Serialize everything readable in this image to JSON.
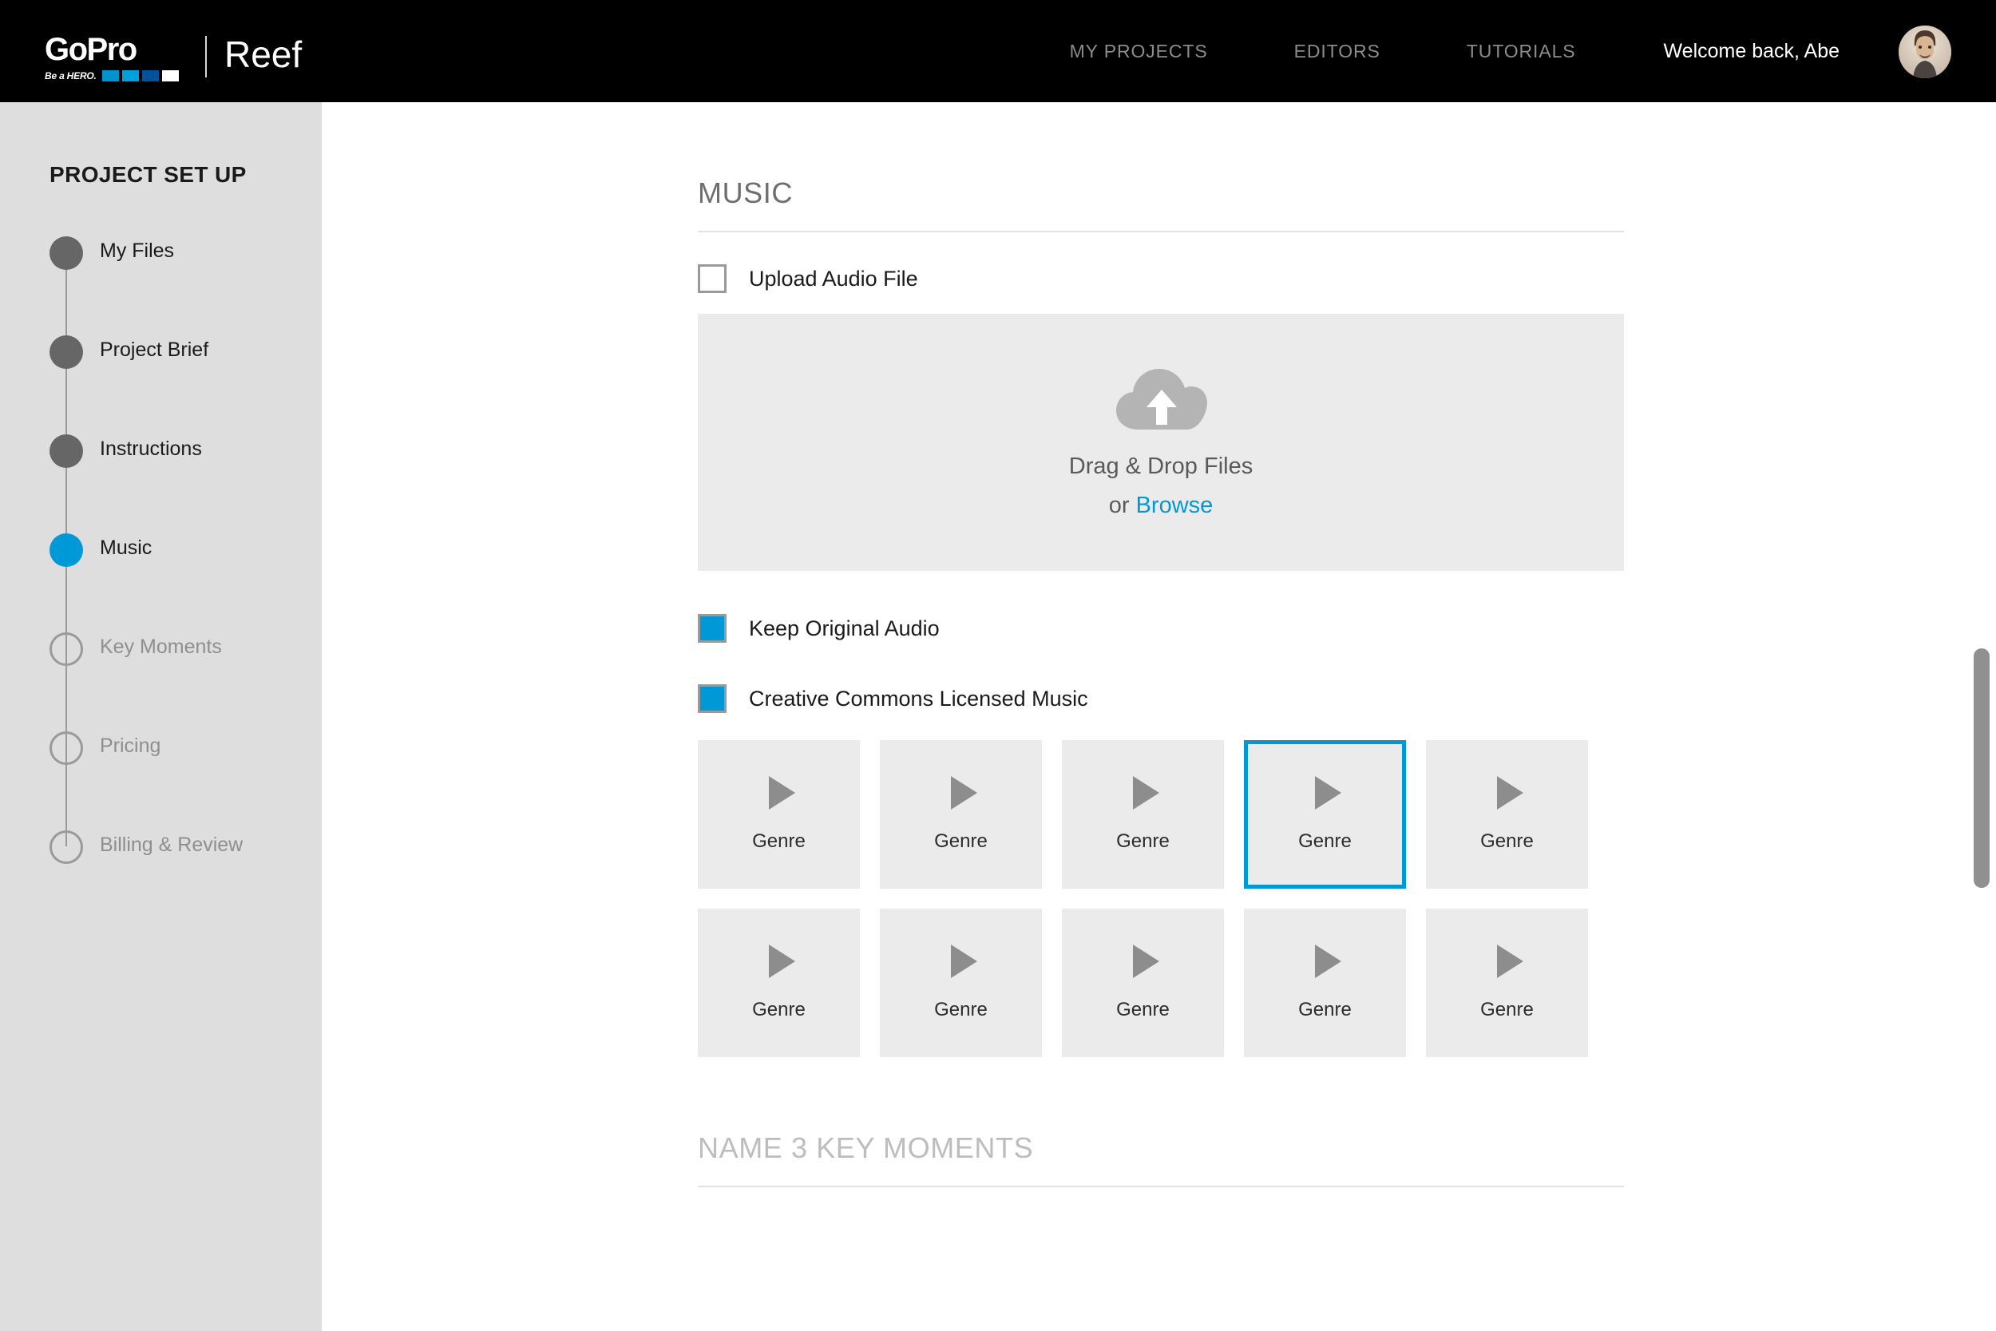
{
  "header": {
    "brand_name": "GoPro",
    "brand_tagline": "Be a HERO.",
    "product_name": "Reef",
    "divider": "|",
    "nav": [
      {
        "label": "MY PROJECTS"
      },
      {
        "label": "EDITORS"
      },
      {
        "label": "TUTORIALS"
      }
    ],
    "welcome_text": "Welcome back, Abe",
    "avatar_icon": "user-avatar-photo",
    "colors": {
      "background": "#000000",
      "nav_text": "#8c8c8c",
      "welcome_text": "#ffffff",
      "logo_sq1": "#0093d0",
      "logo_sq2": "#00a0dc",
      "logo_sq3": "#00539b",
      "logo_sq4": "#ffffff"
    }
  },
  "sidebar": {
    "title": "PROJECT SET UP",
    "background": "#dedede",
    "steps": [
      {
        "label": "My Files",
        "state": "complete"
      },
      {
        "label": "Project Brief",
        "state": "complete"
      },
      {
        "label": "Instructions",
        "state": "complete"
      },
      {
        "label": "Music",
        "state": "active"
      },
      {
        "label": "Key Moments",
        "state": "pending"
      },
      {
        "label": "Pricing",
        "state": "pending"
      },
      {
        "label": "Billing & Review",
        "state": "pending"
      }
    ]
  },
  "main": {
    "music_section": {
      "title": "MUSIC",
      "upload_audio": {
        "label": "Upload Audio File",
        "checked": false
      },
      "dropzone": {
        "icon": "cloud-upload-icon",
        "primary_text": "Drag & Drop Files",
        "or_text": "or ",
        "browse_label": "Browse"
      },
      "keep_original_audio": {
        "label": "Keep Original Audio",
        "checked": true
      },
      "creative_commons": {
        "label": "Creative Commons Licensed Music",
        "checked": true
      },
      "genre_tiles": [
        {
          "label": "Genre",
          "icon": "play-icon",
          "selected": false
        },
        {
          "label": "Genre",
          "icon": "play-icon",
          "selected": false
        },
        {
          "label": "Genre",
          "icon": "play-icon",
          "selected": false
        },
        {
          "label": "Genre",
          "icon": "play-icon",
          "selected": true
        },
        {
          "label": "Genre",
          "icon": "play-icon",
          "selected": false
        },
        {
          "label": "Genre",
          "icon": "play-icon",
          "selected": false
        },
        {
          "label": "Genre",
          "icon": "play-icon",
          "selected": false
        },
        {
          "label": "Genre",
          "icon": "play-icon",
          "selected": false
        },
        {
          "label": "Genre",
          "icon": "play-icon",
          "selected": false
        },
        {
          "label": "Genre",
          "icon": "play-icon",
          "selected": false
        }
      ]
    },
    "key_moments_section": {
      "title": "NAME 3 KEY MOMENTS"
    }
  },
  "theme": {
    "accent_blue": "#0099d8",
    "tile_gray": "#ebebeb",
    "text_dark": "#1a1a1a",
    "text_muted": "#8f8f8f"
  }
}
